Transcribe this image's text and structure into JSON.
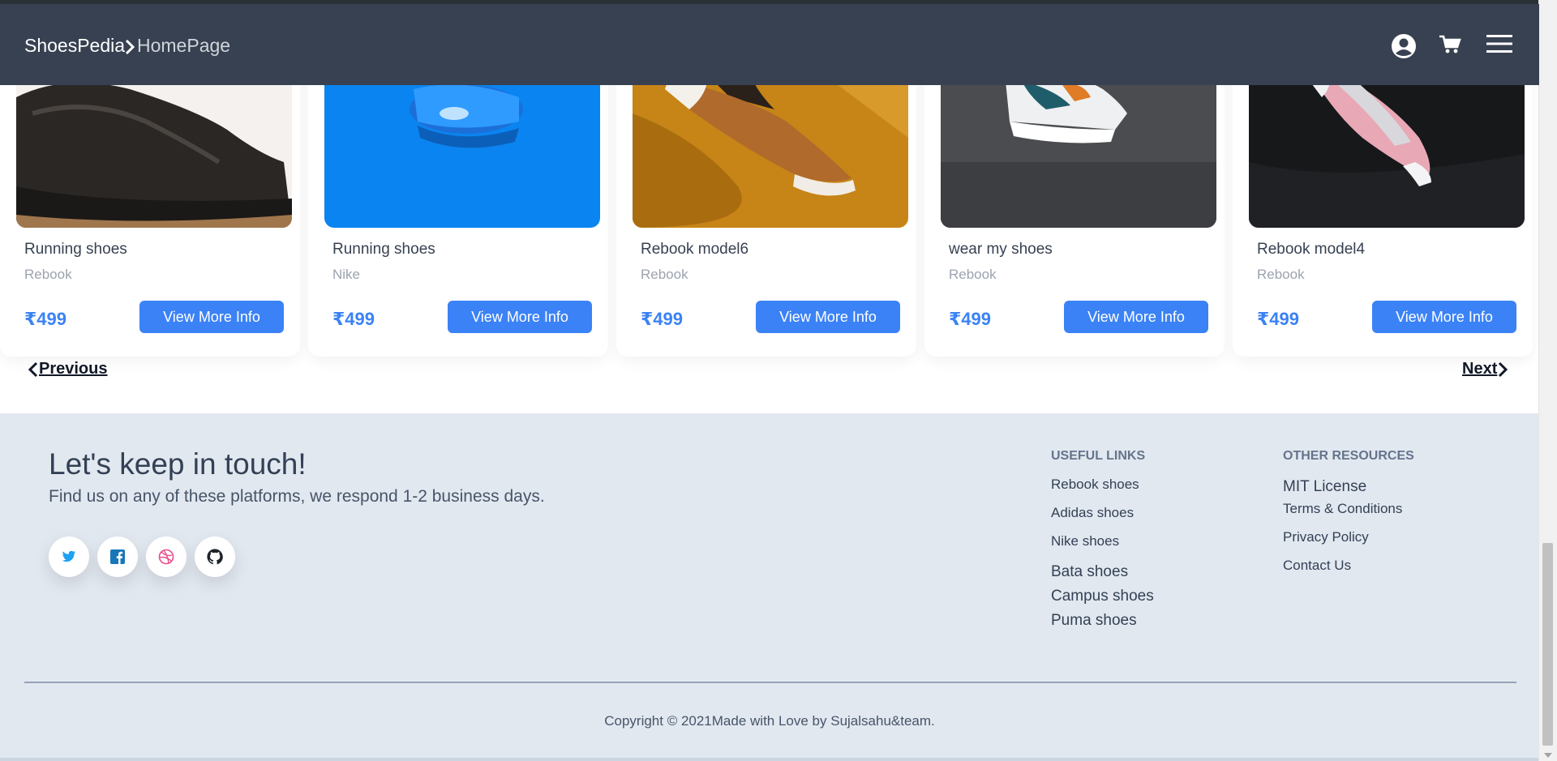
{
  "header": {
    "brand": "ShoesPedia",
    "breadcrumb_page": "HomePage"
  },
  "products": [
    {
      "title": "Running shoes",
      "brand": "Rebook",
      "price": "₹499",
      "button": "View More Info"
    },
    {
      "title": "Running shoes",
      "brand": "Nike",
      "price": "₹499",
      "button": "View More Info"
    },
    {
      "title": "Rebook model6",
      "brand": "Rebook",
      "price": "₹499",
      "button": "View More Info"
    },
    {
      "title": "wear my shoes",
      "brand": "Rebook",
      "price": "₹499",
      "button": "View More Info"
    },
    {
      "title": "Rebook model4",
      "brand": "Rebook",
      "price": "₹499",
      "button": "View More Info"
    }
  ],
  "pagination": {
    "previous": "Previous",
    "next": "Next"
  },
  "footer": {
    "heading": "Let's keep in touch!",
    "subheading": "Find us on any of these platforms, we respond 1-2 business days.",
    "social": [
      "twitter-icon",
      "facebook-icon",
      "dribbble-icon",
      "github-icon"
    ],
    "useful_links": {
      "title": "USEFUL LINKS",
      "items": [
        "Rebook shoes",
        "Adidas shoes",
        "Nike shoes",
        "Bata shoes",
        "Campus shoes",
        "Puma shoes"
      ]
    },
    "other_resources": {
      "title": "OTHER RESOURCES",
      "items": [
        "MIT License",
        "Terms & Conditions",
        "Privacy Policy",
        "Contact Us"
      ]
    },
    "copyright": "Copyright © 2021Made with Love by Sujalsahu&team."
  },
  "colors": {
    "navbar": "#374151",
    "accent": "#3b82f6",
    "footer_bg": "#e2e8f0"
  }
}
